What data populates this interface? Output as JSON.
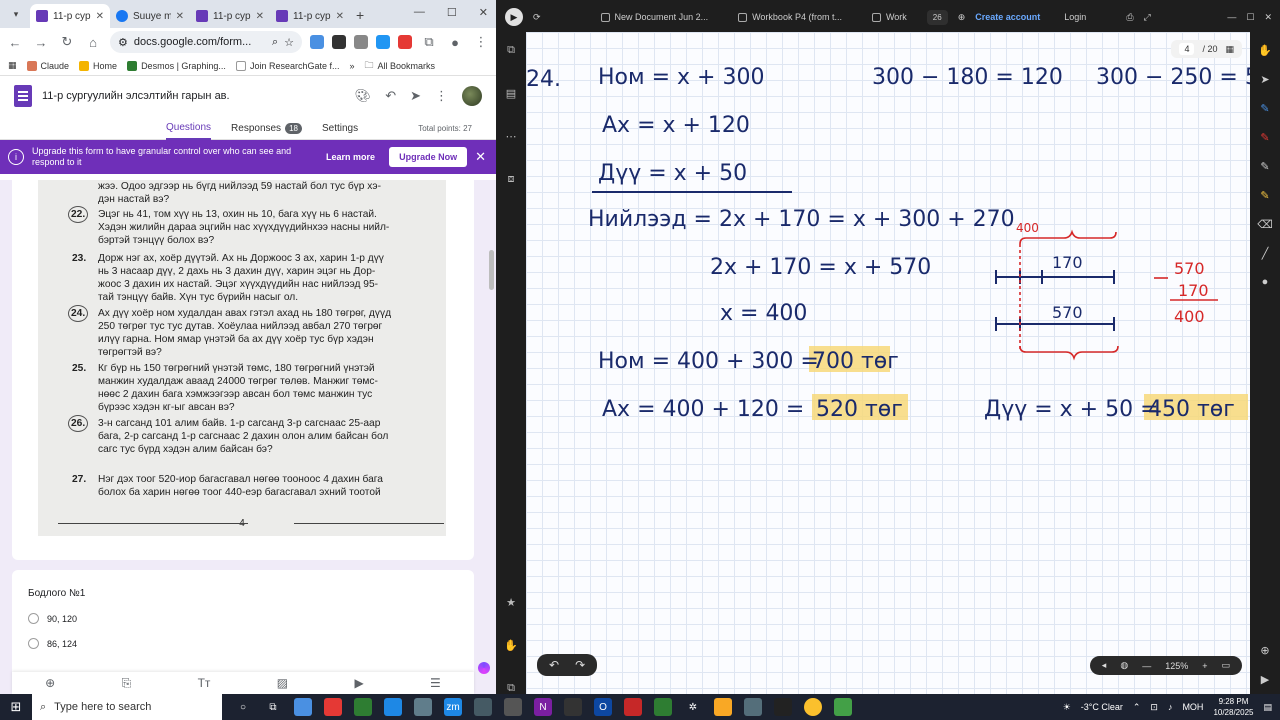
{
  "browser": {
    "tabs": [
      {
        "label": "11-р сур",
        "active": true,
        "color": "#673ab7"
      },
      {
        "label": "Suuye m",
        "active": false,
        "color": "#1877f2"
      },
      {
        "label": "11-р сур",
        "active": false,
        "color": "#673ab7"
      },
      {
        "label": "11-р сур",
        "active": false,
        "color": "#673ab7"
      }
    ],
    "url": "docs.google.com/form...",
    "bookmarks": [
      "Claude",
      "Home",
      "Desmos | Graphing...",
      "Join ResearchGate f..."
    ],
    "all_bookmarks": "All Bookmarks"
  },
  "form": {
    "title": "11-р сургуулийн элсэлтийн гарын ав.",
    "tabs": {
      "questions": "Questions",
      "responses": "Responses",
      "responses_count": "18",
      "settings": "Settings"
    },
    "total_points": "Total points: 27",
    "upgrade": {
      "message": "Upgrade this form to have granular control over who can see and respond to it",
      "learn_more": "Learn more",
      "upgrade_now": "Upgrade Now"
    },
    "question_title": "Бодлого №1",
    "options": [
      "90, 120",
      "86, 124"
    ]
  },
  "worksheet": {
    "lines_top": [
      "жээ. Одоо эдгээр нь бүгд нийлээд 59 настай бол тус бүр хэ-",
      "дэн настай вэ?"
    ],
    "problems": [
      {
        "num": "22.",
        "circled": true,
        "text": [
          "Эцэг нь 41, том хүү нь 13, охин нь 10, бага хүү нь 6 настай.",
          "Хэдэн жилийн дараа эцгийн нас хүүхдүүдийнхээ насны нийл-",
          "бэртэй тэнцүү болох вэ?"
        ]
      },
      {
        "num": "23.",
        "circled": false,
        "text": [
          "Дорж нэг ах, хоёр дүүтэй. Ах нь Доржоос 3 ах, харин 1-р дүү",
          "нь 3 насаар дүү, 2 дахь нь 3 дахин дүү, харин эцэг нь Дор-",
          "жоос 3 дахин их настай. Эцэг хүүхдүүдийн нас нийлээд 95-",
          "тай тэнцүү байв. Хүн тус бүрийн насыг ол."
        ]
      },
      {
        "num": "24.",
        "circled": true,
        "text": [
          "Ах дүү хоёр ном худалдан авах гэтэл ахад нь 180 төгрөг, дүүд",
          "250 төгрөг тус тус дутав. Хоёулаа нийлээд авбал 270 төгрөг",
          "илүү гарна. Ном ямар үнэтэй ба ах дүү хоёр тус бүр хэдэн",
          "төгрөгтэй вэ?"
        ]
      },
      {
        "num": "25.",
        "circled": false,
        "text": [
          "Кг бүр нь 150 төгрөгний үнэтэй төмс, 180 төгрөгний үнэтэй",
          "манжин худалдаж аваад 24000 төгрөг төлөв. Манжиг төмс-",
          "нөөс 2 дахин бага хэмжээгээр авсан бол төмс манжин тус",
          "бүрээс хэдэн кг-ыг авсан вэ?"
        ]
      },
      {
        "num": "26.",
        "circled": true,
        "text": [
          "3-н сагсанд 101 алим байв. 1-р сагсанд 3-р сагснаас 25-аар",
          "бага, 2-р сагсанд 1-р сагснаас 2 дахин олон алим байсан бол",
          "сагс тус бүрд хэдэн алим байсан бэ?"
        ]
      },
      {
        "num": "27.",
        "circled": false,
        "text": [
          "Нэг дэх тоог 520-иор багасгавал нөгөө тооноос 4 дахин бага",
          "болох ба харин нөгөө тоог 440-еэр багасгавал эхний тоотой"
        ]
      }
    ],
    "page_number": "4"
  },
  "notebook": {
    "docs": [
      "New Document Jun 2...",
      "Workbook P4 (from t...",
      "Work"
    ],
    "counter": "26",
    "create_account": "Create account",
    "login": "Login",
    "page_current": "4",
    "page_total": "/ 20",
    "zoom": "125%",
    "sidebar_badge": "20",
    "handwriting": {
      "problem_label": "24.",
      "eq1": "Ном = x + 300",
      "eq2": "Ах = x + 120",
      "eq3": "Дүү = x + 50",
      "eq4": "Нийлээд = 2x + 170 = x + 300 + 270",
      "eq5": "2x + 170 = x + 570",
      "eq6": "x = 400",
      "calc1": "300 − 180 = 120",
      "calc2": "300 − 250 = 50",
      "ans_nom": "Ном = 400 + 300 =",
      "ans_nom_val": "700 төг",
      "ans_ah": "Ах = 400 + 120 =",
      "ans_ah_val": "520 төг",
      "ans_duu": "Дүү = x + 50 =",
      "ans_duu_val": "450 төг",
      "diagram_top": "400",
      "diagram_170": "170",
      "diagram_570": "570",
      "sub_a": "570",
      "sub_b": "170",
      "sub_res": "400",
      "ink": "#1a2a6b",
      "red_ink": "#d62828"
    }
  },
  "taskbar": {
    "search_placeholder": "Type here to search",
    "weather": "-3°C  Clear",
    "lang": "МОН",
    "time": "9:28 PM",
    "date": "10/28/2025"
  }
}
